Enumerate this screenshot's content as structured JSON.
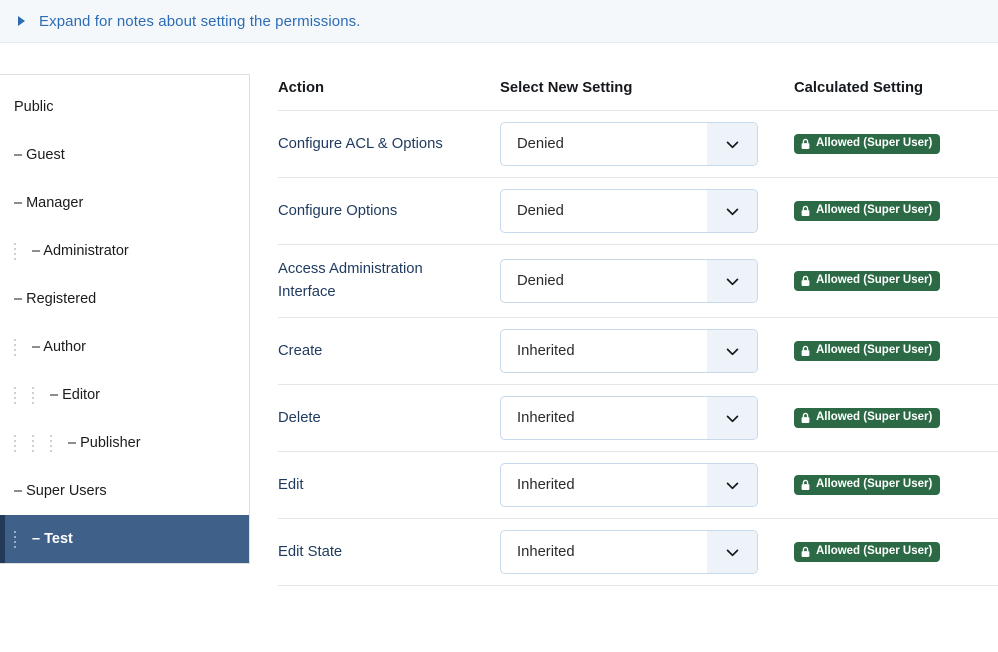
{
  "notice": {
    "icon": "triangle-right-icon",
    "text": "Expand for notes about setting the permissions.",
    "color": "#2d6cb5"
  },
  "sidebar": {
    "items": [
      {
        "label": "Public",
        "depth": 0,
        "selected": false
      },
      {
        "label": "– Guest",
        "depth": 0,
        "selected": false
      },
      {
        "label": "– Manager",
        "depth": 0,
        "selected": false
      },
      {
        "label": "– Administrator",
        "depth": 1,
        "selected": false
      },
      {
        "label": "– Registered",
        "depth": 0,
        "selected": false
      },
      {
        "label": "– Author",
        "depth": 1,
        "selected": false
      },
      {
        "label": "– Editor",
        "depth": 2,
        "selected": false
      },
      {
        "label": "– Publisher",
        "depth": 3,
        "selected": false
      },
      {
        "label": "– Super Users",
        "depth": 0,
        "selected": false
      },
      {
        "label": "– Test",
        "depth": 1,
        "selected": true
      }
    ],
    "selected_bg": "#3f6089",
    "selected_accent": "#233a59"
  },
  "table": {
    "headers": {
      "action": "Action",
      "select": "Select New Setting",
      "calculated": "Calculated Setting"
    },
    "badge_color": "#2b6a45",
    "rows": [
      {
        "action": "Configure ACL & Options",
        "setting": "Denied",
        "calculated": "Allowed (Super User)",
        "lock": "lock-icon"
      },
      {
        "action": "Configure Options",
        "setting": "Denied",
        "calculated": "Allowed (Super User)",
        "lock": "lock-icon"
      },
      {
        "action": "Access Administration Interface",
        "setting": "Denied",
        "calculated": "Allowed (Super User)",
        "lock": "lock-icon"
      },
      {
        "action": "Create",
        "setting": "Inherited",
        "calculated": "Allowed (Super User)",
        "lock": "lock-icon"
      },
      {
        "action": "Delete",
        "setting": "Inherited",
        "calculated": "Allowed (Super User)",
        "lock": "lock-icon"
      },
      {
        "action": "Edit",
        "setting": "Inherited",
        "calculated": "Allowed (Super User)",
        "lock": "lock-icon"
      },
      {
        "action": "Edit State",
        "setting": "Inherited",
        "calculated": "Allowed (Super User)",
        "lock": "lock-icon"
      }
    ]
  }
}
